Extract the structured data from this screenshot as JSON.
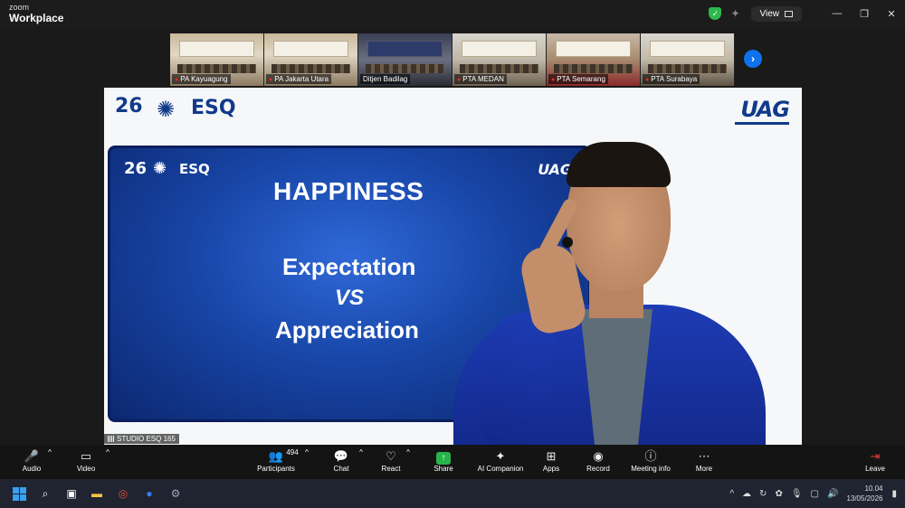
{
  "app": {
    "brand_small": "zoom",
    "brand_big": "Workplace"
  },
  "titlebar": {
    "view_label": "View",
    "minimize": "—",
    "restore": "❐",
    "close": "✕"
  },
  "thumbnails": [
    {
      "label": "PA Kayuagung"
    },
    {
      "label": "PA Jakarta Utara"
    },
    {
      "label": "Ditjen Badilag"
    },
    {
      "label": "PTA MEDAN"
    },
    {
      "label": "PTA Semarang"
    },
    {
      "label": "PTA Surabaya"
    }
  ],
  "video": {
    "logo_26": "26",
    "logo_esq": "ESQ",
    "logo_uag": "UAG",
    "name_tag": "STUDIO ESQ 165"
  },
  "slide": {
    "logo_26": "26",
    "logo_esq": "ESQ",
    "logo_uag": "UAG",
    "title": "HAPPINESS",
    "line1": "Expectation",
    "vs": "VS",
    "line2": "Appreciation"
  },
  "toolbar": {
    "audio": "Audio",
    "video": "Video",
    "participants": "Participants",
    "participants_count": "494",
    "chat": "Chat",
    "react": "React",
    "share": "Share",
    "ai_companion": "AI Companion",
    "apps": "Apps",
    "record": "Record",
    "meeting_info": "Meeting info",
    "more": "More",
    "leave": "Leave"
  },
  "taskbar": {
    "time": "10.04",
    "date": "13/05/2026"
  },
  "colors": {
    "accent": "#0e72ed",
    "share_green": "#27b34a",
    "leave_red": "#e03b3b"
  }
}
